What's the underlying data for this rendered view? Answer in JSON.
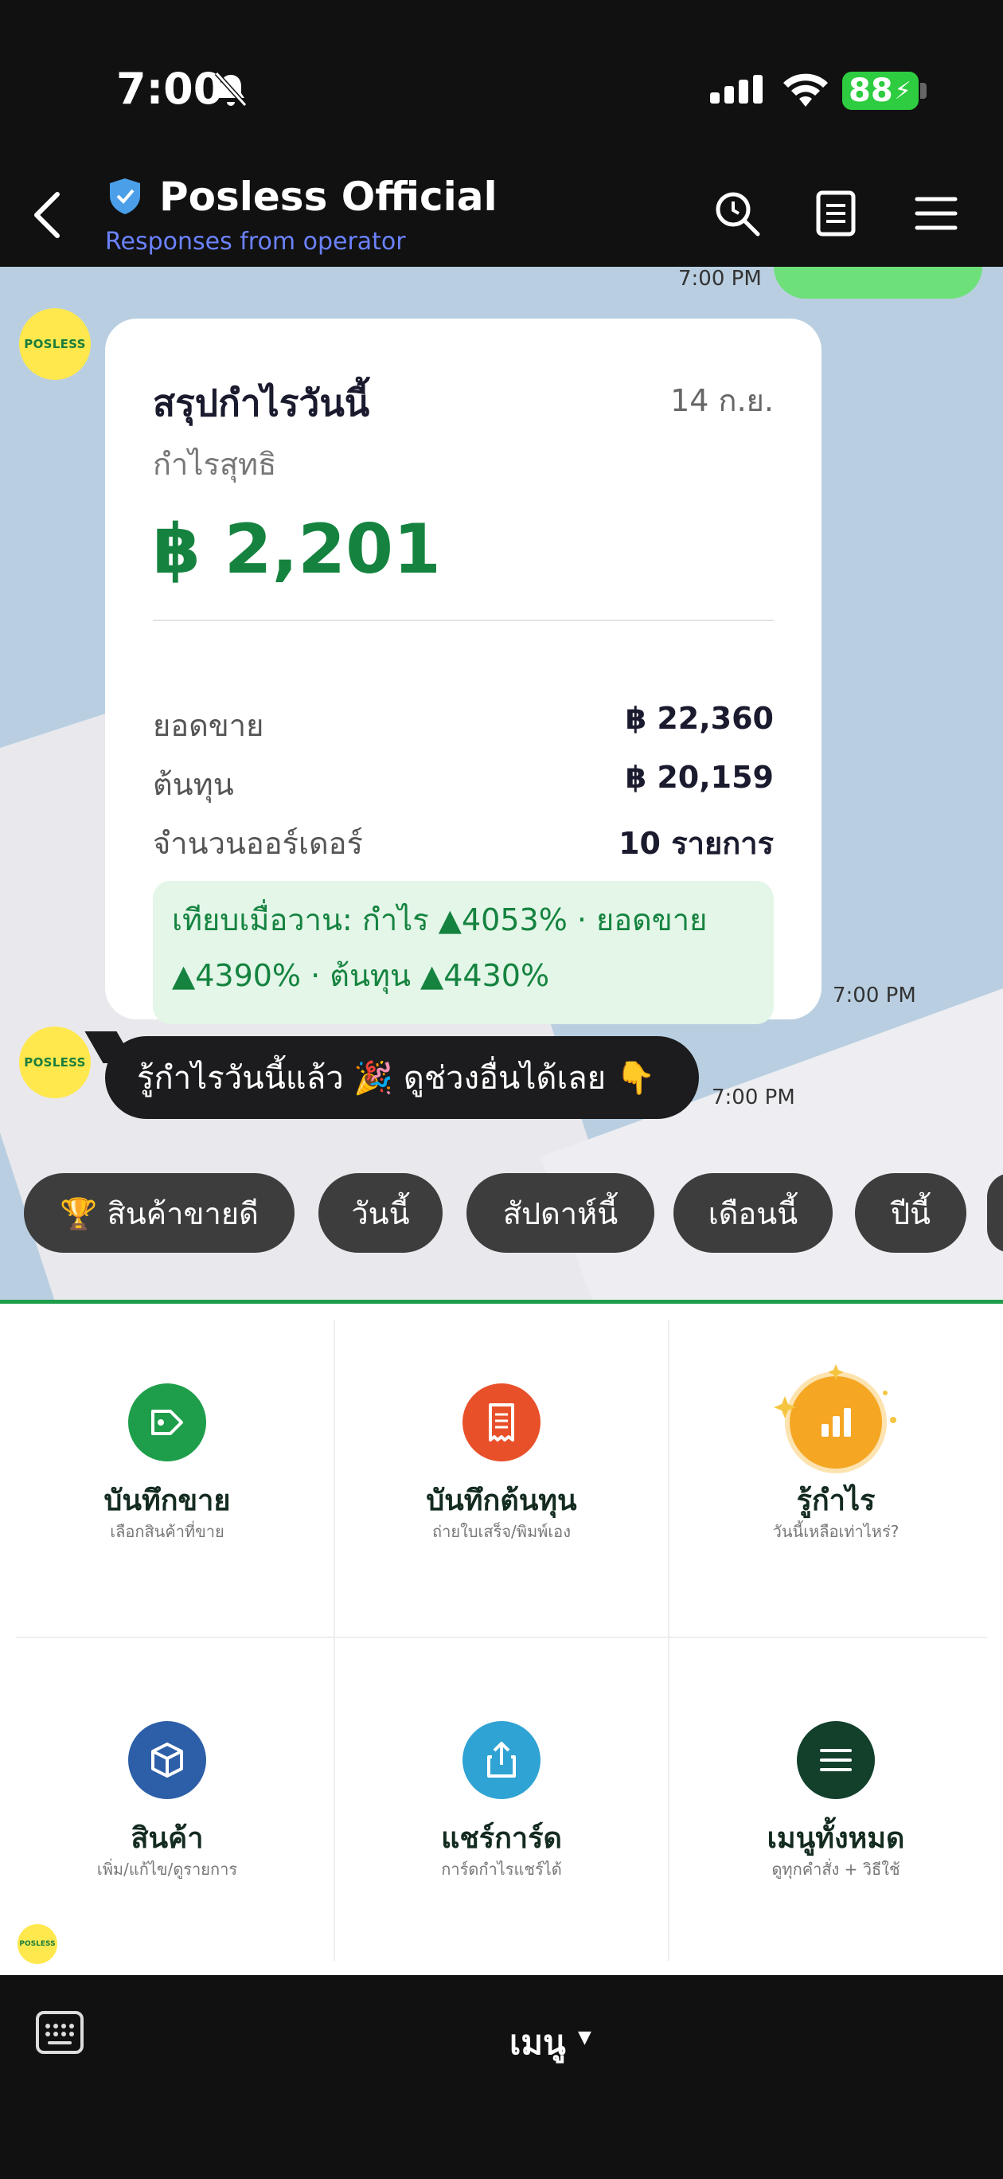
{
  "status_bar": {
    "time": "7:00",
    "battery": "88"
  },
  "header": {
    "title": "Posless Official",
    "subtitle": "Responses from operator"
  },
  "chat": {
    "avatar_text": "POSLESS",
    "timestamps": {
      "top": "7:00 PM",
      "card": "7:00 PM",
      "bubble": "7:00 PM"
    },
    "card": {
      "title": "สรุปกำไรวันนี้",
      "date": "14 ก.ย.",
      "net_label": "กำไรสุทธิ",
      "net_value": "฿ 2,201",
      "rows": [
        {
          "label": "ยอดขาย",
          "value": "฿ 22,360"
        },
        {
          "label": "ต้นทุน",
          "value": "฿ 20,159"
        },
        {
          "label": "จำนวนออร์เดอร์",
          "value": "10 รายการ"
        }
      ],
      "compare_line1": "เทียบเมื่อวาน: กำไร ▲4053% · ยอดขาย",
      "compare_line2": "▲4390% · ต้นทุน ▲4430%"
    },
    "message": "รู้กำไรวันนี้แล้ว 🎉 ดูช่วงอื่นได้เลย 👇",
    "quick_replies": [
      "🏆 สินค้าขายดี",
      "วันนี้",
      "สัปดาห์นี้",
      "เดือนนี้",
      "ปีนี้"
    ]
  },
  "rich_menu": {
    "items": [
      {
        "label": "บันทึกขาย",
        "sub": "เลือกสินค้าที่ขาย",
        "icon": "tag-icon",
        "color": "#1e9e4a"
      },
      {
        "label": "บันทึกต้นทุน",
        "sub": "ถ่ายใบเสร็จ/พิมพ์เอง",
        "icon": "receipt-icon",
        "color": "#e8502a"
      },
      {
        "label": "รู้กำไร",
        "sub": "วันนี้เหลือเท่าไหร่?",
        "icon": "bar-chart-icon",
        "color": "#f5a623"
      },
      {
        "label": "สินค้า",
        "sub": "เพิ่ม/แก้ไข/ดูรายการ",
        "icon": "box-icon",
        "color": "#2d5fa8"
      },
      {
        "label": "แชร์การ์ด",
        "sub": "การ์ดกำไรแชร์ได้",
        "icon": "share-icon",
        "color": "#2fa3d3"
      },
      {
        "label": "เมนูทั้งหมด",
        "sub": "ดูทุกคำสั่ง + วิธีใช้",
        "icon": "menu-icon",
        "color": "#12402b"
      }
    ]
  },
  "bottom_bar": {
    "menu_label": "เมนู",
    "caret": "▼"
  }
}
